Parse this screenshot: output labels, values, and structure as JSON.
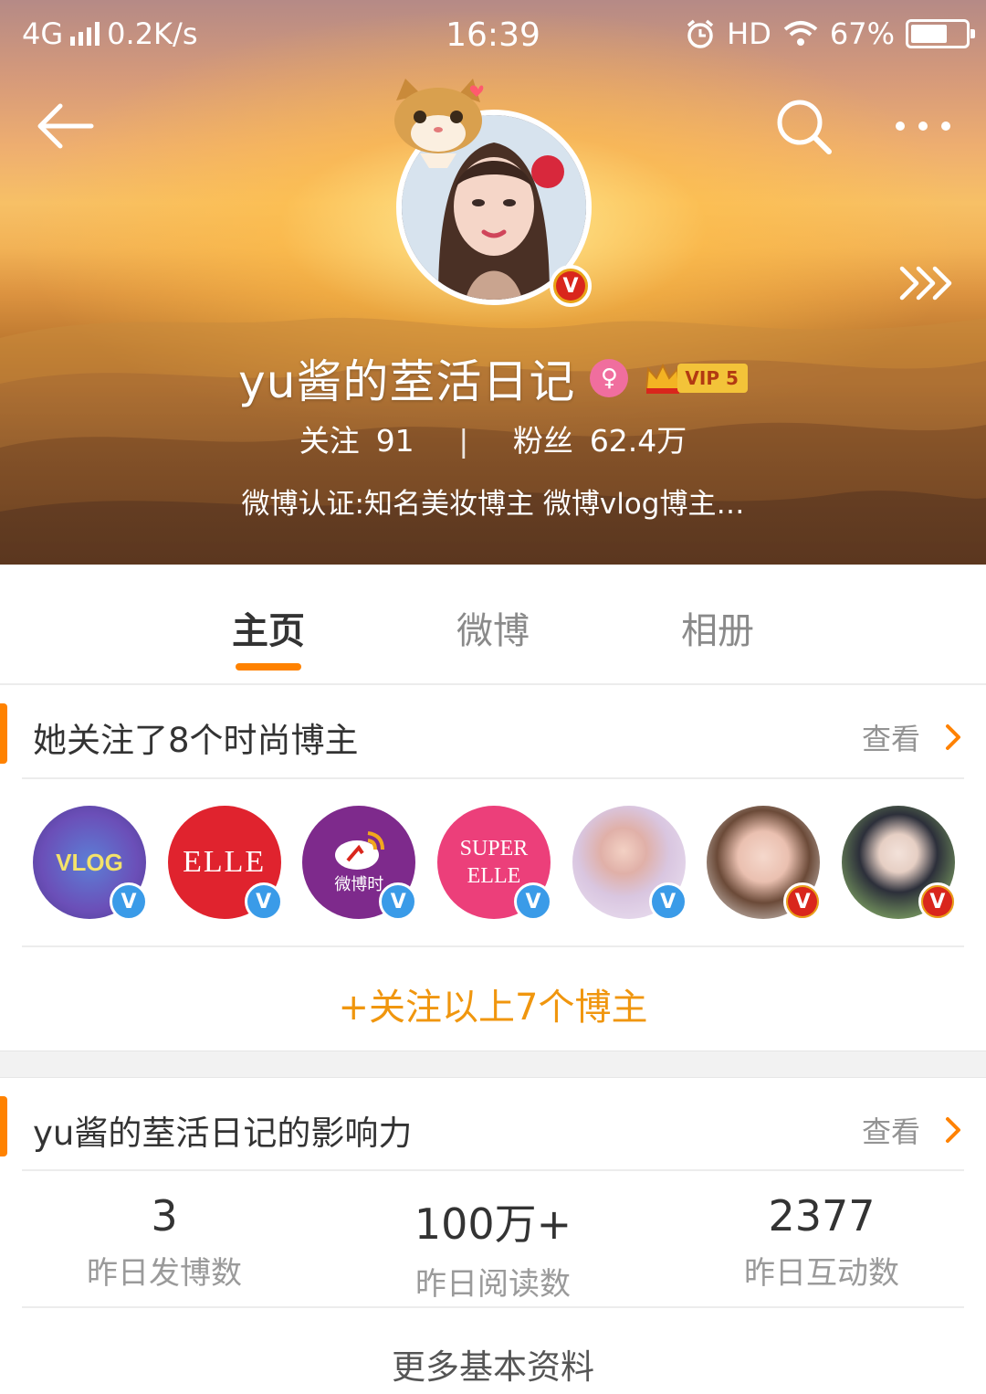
{
  "status_bar": {
    "network": "4G",
    "speed": "0.2K/s",
    "time": "16:39",
    "hd": "HD",
    "battery": "67%",
    "battery_level": 0.67
  },
  "profile": {
    "username": "yu酱的荎活日记",
    "vip_label": "VIP 5",
    "gender_symbol": "♀",
    "following_label": "关注",
    "following_count": "91",
    "separator": "|",
    "followers_label": "粉丝",
    "followers_count": "62.4万",
    "verification": "微博认证:知名美妆博主 微博vlog博主…",
    "verified_mark": "V"
  },
  "tabs": [
    {
      "label": "主页",
      "active": true
    },
    {
      "label": "微博",
      "active": false
    },
    {
      "label": "相册",
      "active": false
    }
  ],
  "fashion_section": {
    "title": "她关注了8个时尚博主",
    "more_label": "查看",
    "bloggers": [
      {
        "avatar_text": "VLOG",
        "badge": "V",
        "badge_color": "#3a9be8"
      },
      {
        "avatar_text": "ELLE",
        "badge": "V",
        "badge_color": "#3a9be8"
      },
      {
        "avatar_text": "微博时",
        "badge": "V",
        "badge_color": "#3a9be8"
      },
      {
        "avatar_text": "SUPER ELLE",
        "badge": "V",
        "badge_color": "#3a9be8"
      },
      {
        "avatar_text": "",
        "badge": "V",
        "badge_color": "#3a9be8"
      },
      {
        "avatar_text": "",
        "badge": "V",
        "badge_color": "#d9261c"
      },
      {
        "avatar_text": "",
        "badge": "V",
        "badge_color": "#d9261c"
      }
    ],
    "follow_all_label": "+关注以上7个博主"
  },
  "influence_section": {
    "title": "yu酱的荎活日记的影响力",
    "more_label": "查看",
    "stats": [
      {
        "value": "3",
        "label": "昨日发博数"
      },
      {
        "value": "100万+",
        "label": "昨日阅读数"
      },
      {
        "value": "2377",
        "label": "昨日互动数"
      }
    ]
  },
  "more_info_label": "更多基本资料",
  "colors": {
    "accent": "#ff8200",
    "follow_all": "#f0960e",
    "verified_blue": "#3a9be8",
    "verified_red": "#d9261c"
  },
  "icons": [
    "back-arrow-icon",
    "search-icon",
    "more-icon",
    "forward-arrows-icon",
    "chevron-right-icon",
    "cat-sticker-icon",
    "crown-icon"
  ]
}
